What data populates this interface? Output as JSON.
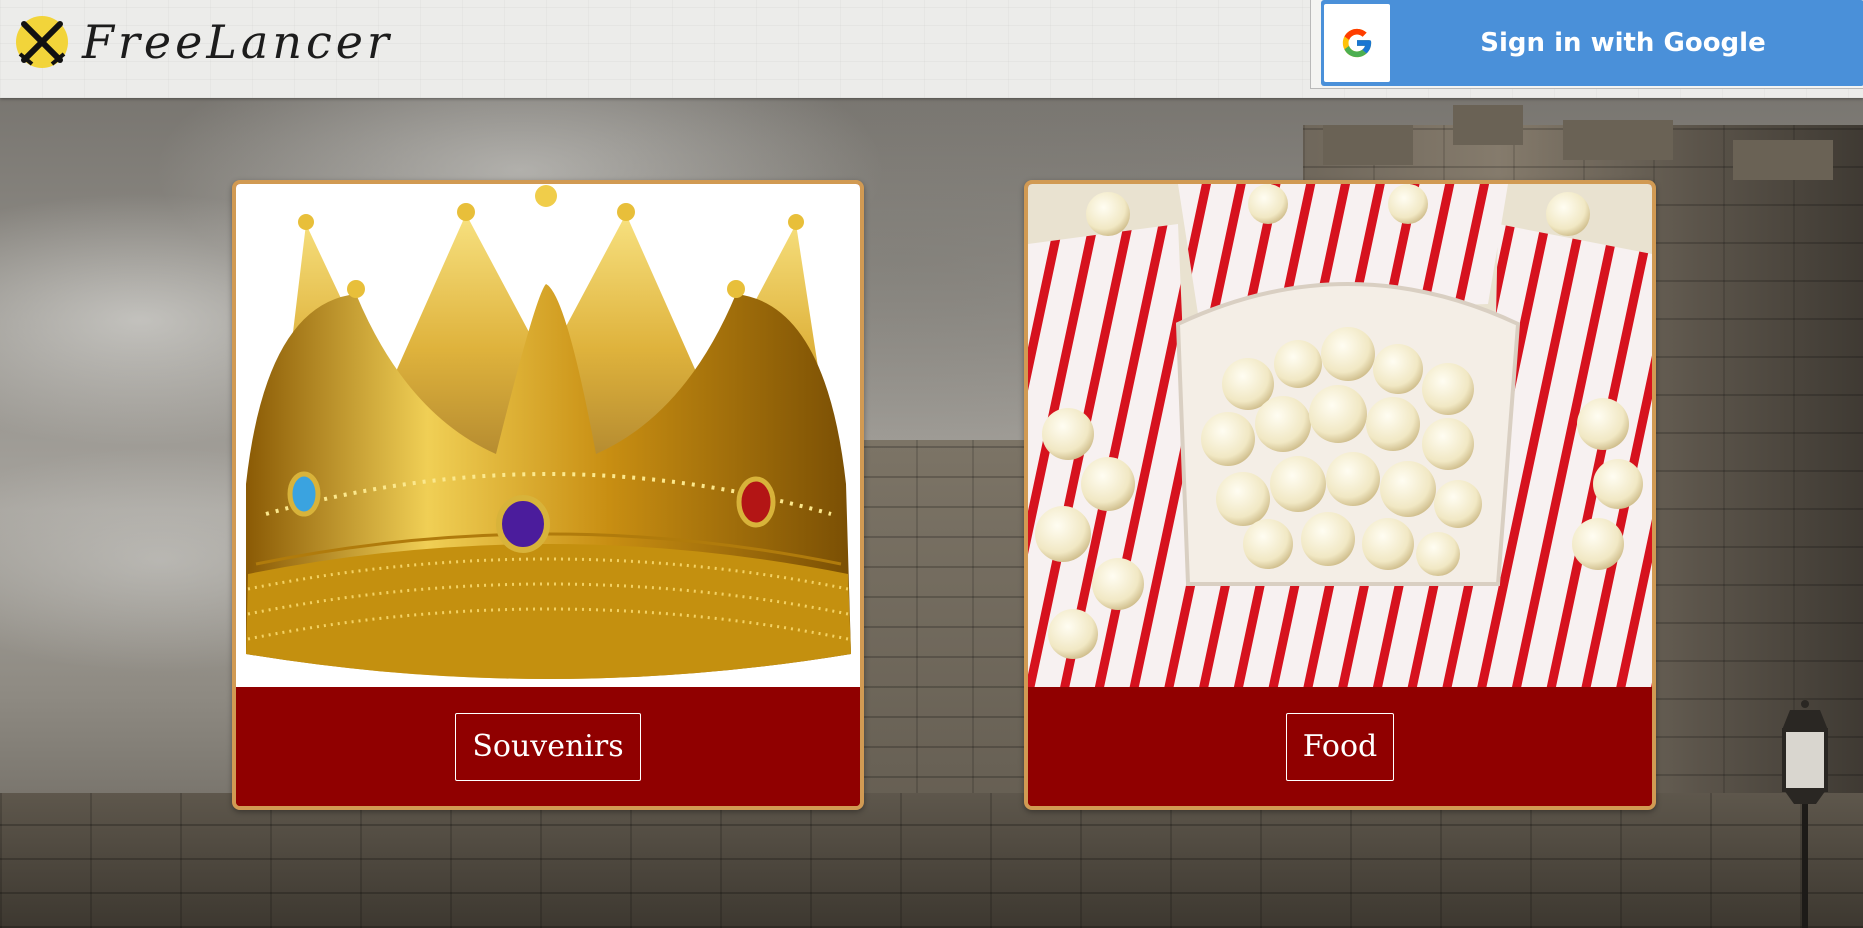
{
  "header": {
    "brand_name": "FreeLancer",
    "logo_icon": "crossed-swords-icon",
    "sign_in": {
      "label": "Sign in with Google",
      "icon": "google-g-icon",
      "color": "#4a90d9"
    }
  },
  "categories": [
    {
      "label": "Souvenirs",
      "image": "gold-crown-photo"
    },
    {
      "label": "Food",
      "image": "popcorn-boxes-photo"
    }
  ],
  "theme": {
    "card_border": "#d19a53",
    "card_footer": "#900000"
  }
}
